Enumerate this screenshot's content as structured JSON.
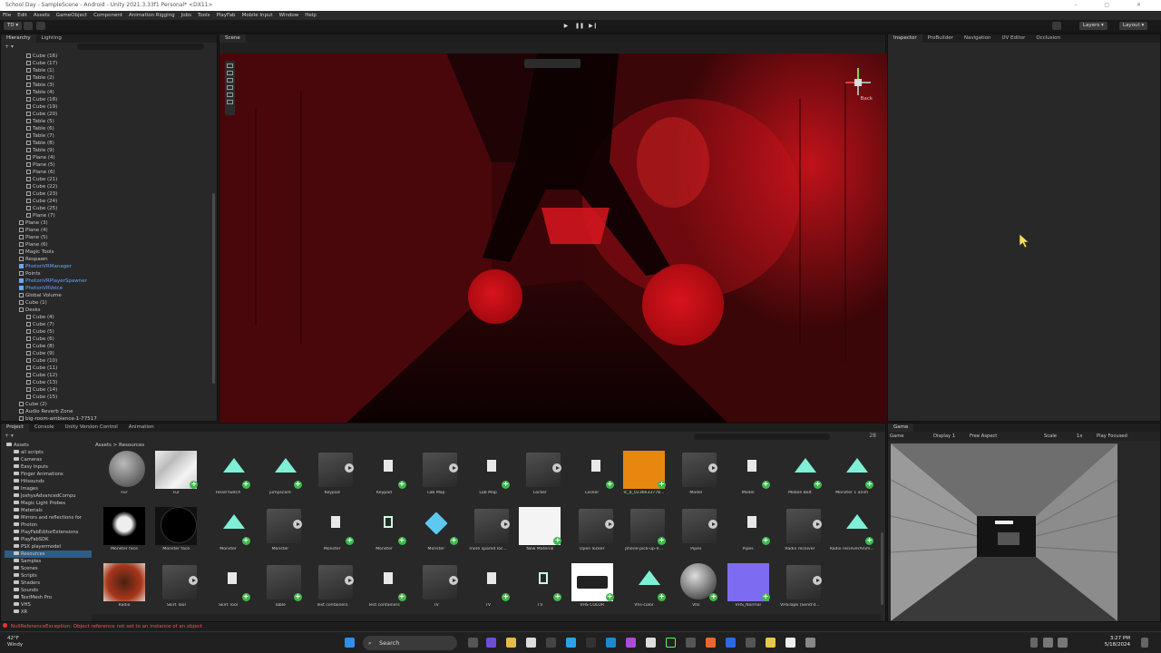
{
  "window": {
    "title": "School Day - SampleScene - Android - Unity 2021.3.33f1 Personal* <DX11>"
  },
  "menu": [
    "File",
    "Edit",
    "Assets",
    "GameObject",
    "Component",
    "Animation Rigging",
    "Jobs",
    "Tools",
    "PlayFab",
    "Mobile Input",
    "Window",
    "Help"
  ],
  "toolbar": {
    "account": "TD",
    "layers": "Layers",
    "layout": "Layout"
  },
  "hierarchy": {
    "tabs": [
      "Hierarchy",
      "Lighting"
    ],
    "rows": [
      {
        "t": "Cube (16)",
        "d": 3
      },
      {
        "t": "Cube (17)",
        "d": 3
      },
      {
        "t": "Table (1)",
        "d": 3
      },
      {
        "t": "Table (2)",
        "d": 3
      },
      {
        "t": "Table (3)",
        "d": 3
      },
      {
        "t": "Table (4)",
        "d": 3
      },
      {
        "t": "Cube (18)",
        "d": 3
      },
      {
        "t": "Cube (19)",
        "d": 3
      },
      {
        "t": "Cube (20)",
        "d": 3
      },
      {
        "t": "Table (5)",
        "d": 3
      },
      {
        "t": "Table (6)",
        "d": 3
      },
      {
        "t": "Table (7)",
        "d": 3
      },
      {
        "t": "Table (8)",
        "d": 3
      },
      {
        "t": "Table (9)",
        "d": 3
      },
      {
        "t": "Plane (4)",
        "d": 3
      },
      {
        "t": "Plane (5)",
        "d": 3
      },
      {
        "t": "Plane (6)",
        "d": 3
      },
      {
        "t": "Cube (21)",
        "d": 3
      },
      {
        "t": "Cube (22)",
        "d": 3
      },
      {
        "t": "Cube (23)",
        "d": 3
      },
      {
        "t": "Cube (24)",
        "d": 3
      },
      {
        "t": "Cube (25)",
        "d": 3
      },
      {
        "t": "Plane (7)",
        "d": 3
      },
      {
        "t": "Plane (3)",
        "d": 2
      },
      {
        "t": "Plane (4)",
        "d": 2
      },
      {
        "t": "Plane (5)",
        "d": 2
      },
      {
        "t": "Plane (6)",
        "d": 2
      },
      {
        "t": "Magic Tools",
        "d": 2
      },
      {
        "t": "Respawn",
        "d": 2
      },
      {
        "t": "PhotonVRManager",
        "d": 2,
        "blue": true
      },
      {
        "t": "Points",
        "d": 2
      },
      {
        "t": "PhotonVRPlayerSpawner",
        "d": 2,
        "blue": true
      },
      {
        "t": "PhotonVRVoice",
        "d": 2,
        "blue": true
      },
      {
        "t": "Global Volume",
        "d": 2
      },
      {
        "t": "Cube (1)",
        "d": 2
      },
      {
        "t": "Desks",
        "d": 2
      },
      {
        "t": "Cube (4)",
        "d": 3
      },
      {
        "t": "Cube (7)",
        "d": 3
      },
      {
        "t": "Cube (5)",
        "d": 3
      },
      {
        "t": "Cube (6)",
        "d": 3
      },
      {
        "t": "Cube (8)",
        "d": 3
      },
      {
        "t": "Cube (9)",
        "d": 3
      },
      {
        "t": "Cube (10)",
        "d": 3
      },
      {
        "t": "Cube (11)",
        "d": 3
      },
      {
        "t": "Cube (12)",
        "d": 3
      },
      {
        "t": "Cube (13)",
        "d": 3
      },
      {
        "t": "Cube (14)",
        "d": 3
      },
      {
        "t": "Cube (15)",
        "d": 3
      },
      {
        "t": "Cube (2)",
        "d": 2
      },
      {
        "t": "Audio Reverb Zone",
        "d": 2
      },
      {
        "t": "big-room-ambience-1-77517",
        "d": 2
      }
    ]
  },
  "scene": {
    "tab": "Scene",
    "gizmo_label": "Back"
  },
  "inspector": {
    "tabs": [
      "Inspector",
      "ProBuilder",
      "Navigation",
      "UV Editor",
      "Occlusion"
    ]
  },
  "project": {
    "tabs": [
      "Project",
      "Console",
      "Unity Version Control",
      "Animation"
    ],
    "breadcrumb": "Assets > Resources",
    "count": "28",
    "tree": [
      {
        "t": "Assets",
        "d": 0
      },
      {
        "t": "all scripts",
        "d": 1
      },
      {
        "t": "Cameras",
        "d": 1
      },
      {
        "t": "Easy Inputs",
        "d": 1
      },
      {
        "t": "Finger Animations",
        "d": 1
      },
      {
        "t": "Hitsounds",
        "d": 1
      },
      {
        "t": "Images",
        "d": 1
      },
      {
        "t": "JoshysAdvancedCompu",
        "d": 1
      },
      {
        "t": "Magic Light Probes",
        "d": 1
      },
      {
        "t": "Materials",
        "d": 1
      },
      {
        "t": "Mirrors and reflections for",
        "d": 1
      },
      {
        "t": "Photon",
        "d": 1
      },
      {
        "t": "PlayFabEditorExtensions",
        "d": 1
      },
      {
        "t": "PlayFabSDK",
        "d": 1
      },
      {
        "t": "PSX playermodel",
        "d": 1
      },
      {
        "t": "Resources",
        "d": 1,
        "sel": true
      },
      {
        "t": "Samples",
        "d": 1
      },
      {
        "t": "Scenes",
        "d": 1
      },
      {
        "t": "Scripts",
        "d": 1
      },
      {
        "t": "Shaders",
        "d": 1
      },
      {
        "t": "Sounds",
        "d": 1
      },
      {
        "t": "TextMesh Pro",
        "d": 1
      },
      {
        "t": "VHS",
        "d": 1
      },
      {
        "t": "XR",
        "d": 1
      }
    ],
    "assets": [
      {
        "n": "Fur",
        "k": "ball"
      },
      {
        "n": "Fur",
        "k": "noise",
        "add": true
      },
      {
        "n": "Head twitch",
        "k": "tri",
        "add": true
      },
      {
        "n": "jumpscare",
        "k": "tri",
        "add": true
      },
      {
        "n": "Keypad",
        "k": "model",
        "play": true
      },
      {
        "n": "Keypad",
        "k": "file",
        "add": true
      },
      {
        "n": "Lab Map",
        "k": "model",
        "play": true
      },
      {
        "n": "Lab Map",
        "k": "file",
        "add": true
      },
      {
        "n": "Locker",
        "k": "model",
        "play": true
      },
      {
        "n": "Locker",
        "k": "file",
        "add": true
      },
      {
        "n": "lc_b_0236633778...",
        "k": "orange",
        "add": true
      },
      {
        "n": "Model",
        "k": "model",
        "play": true
      },
      {
        "n": "Model",
        "k": "file",
        "add": true
      },
      {
        "n": "Mobile Bolt",
        "k": "tri",
        "add": true
      },
      {
        "n": "Monster 1 anim",
        "k": "tri",
        "add": true
      },
      {
        "n": "Monster face",
        "k": "face"
      },
      {
        "n": "Monster face",
        "k": "black"
      },
      {
        "n": "Monster",
        "k": "tri",
        "add": true
      },
      {
        "n": "Monster",
        "k": "model",
        "play": true
      },
      {
        "n": "Monster",
        "k": "file",
        "add": true
      },
      {
        "n": "Monster",
        "k": "prefabv",
        "add": true
      },
      {
        "n": "Monster",
        "k": "prefab",
        "add": true
      },
      {
        "n": "more spared loc...",
        "k": "model",
        "play": true
      },
      {
        "n": "New Material",
        "k": "white",
        "add": true
      },
      {
        "n": "Open locker",
        "k": "model",
        "play": true
      },
      {
        "n": "phone-pick-up-4...",
        "k": "model",
        "add": true
      },
      {
        "n": "Pipes",
        "k": "model",
        "play": true
      },
      {
        "n": "Pipes",
        "k": "file",
        "add": true
      },
      {
        "n": "Radio receiver",
        "k": "model",
        "play": true
      },
      {
        "n": "Radio recieverAnim...",
        "k": "tri",
        "add": true
      },
      {
        "n": "Radio",
        "k": "radio"
      },
      {
        "n": "Skirt Tool",
        "k": "model",
        "play": true
      },
      {
        "n": "Skirt Tool",
        "k": "file",
        "add": true
      },
      {
        "n": "Table",
        "k": "model",
        "add": true
      },
      {
        "n": "Test containers",
        "k": "model",
        "play": true
      },
      {
        "n": "Test containers",
        "k": "file",
        "add": true
      },
      {
        "n": "TV",
        "k": "model",
        "play": true
      },
      {
        "n": "TV",
        "k": "file",
        "add": true
      },
      {
        "n": "TV",
        "k": "prefabv",
        "add": true
      },
      {
        "n": "VHS COLOR",
        "k": "vhs",
        "add": true
      },
      {
        "n": "Vhs-color",
        "k": "tri",
        "add": true
      },
      {
        "n": "Vhs",
        "k": "ball2",
        "add": true
      },
      {
        "n": "VHS_Normal",
        "k": "purple",
        "add": true
      },
      {
        "n": "VHSTape (Send'd...",
        "k": "model",
        "play": true
      }
    ]
  },
  "game": {
    "tab": "Game",
    "display": "Display 1",
    "aspect": "Free Aspect",
    "scale": "Scale",
    "scale_value": "1x",
    "play_focused": "Play Focused"
  },
  "status": {
    "message": "NullReferenceException: Object reference not set to an instance of an object"
  },
  "taskbar": {
    "weather_temp": "42°F",
    "weather_desc": "Windy",
    "search_label": "Search",
    "time": "3:27 PM",
    "date": "5/18/2024"
  }
}
